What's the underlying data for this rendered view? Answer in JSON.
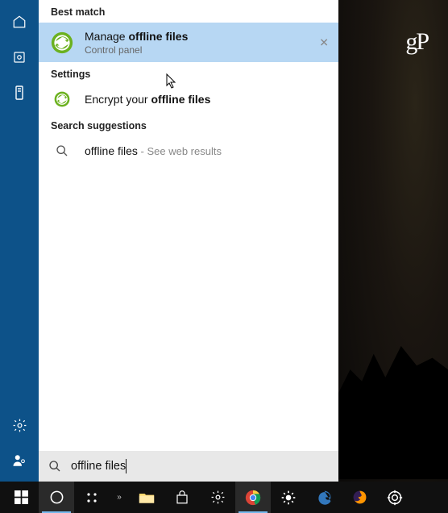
{
  "logo": "gP",
  "sections": {
    "best_match": "Best match",
    "settings": "Settings",
    "suggestions": "Search suggestions"
  },
  "results": {
    "manage": {
      "prefix": "Manage ",
      "bold": "offline files",
      "sub": "Control panel"
    },
    "encrypt": {
      "prefix": "Encrypt your ",
      "bold": "offline files"
    },
    "web": {
      "query": "offline files",
      "suffix": " - See web results"
    }
  },
  "search": {
    "value": "offline files"
  },
  "icons": {
    "home": "home-icon",
    "recent": "recent-icon",
    "server": "server-icon",
    "settings": "gear-icon",
    "user": "user-icon",
    "sync": "sync-icon",
    "search": "search-icon",
    "close": "close-icon"
  }
}
